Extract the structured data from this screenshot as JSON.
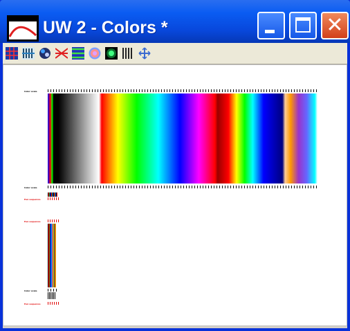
{
  "window": {
    "title": "UW 2 - Colors *",
    "buttons": {
      "minimize": "_",
      "maximize": "□",
      "close": "✕"
    }
  },
  "toolbar": {
    "tools": [
      {
        "name": "grid-tool-icon",
        "color": "#1a3aa8"
      },
      {
        "name": "filter-tool-icon",
        "color": "#2a6a8a"
      },
      {
        "name": "palette-tool-icon",
        "color": "#20306a"
      },
      {
        "name": "ray-tool-icon",
        "color": "#e01f1f"
      },
      {
        "name": "waves-tool-icon",
        "color": "#2aa83a"
      },
      {
        "name": "target-tool-icon",
        "color": "#e07070"
      },
      {
        "name": "ring-tool-icon",
        "color": "#0c6a2a"
      },
      {
        "name": "bars-tool-icon",
        "color": "#222222"
      },
      {
        "name": "move-tool-icon",
        "color": "#3a6ad0"
      }
    ]
  },
  "plot": {
    "labels": {
      "color_scale_top": "Color scale",
      "color_scale_bottom": "Color scale",
      "red_row_1": "Pen sequence",
      "red_row_2": "Pen sequence",
      "bottom_black": "Color scale",
      "red_row_3": "Pen sequence"
    }
  }
}
